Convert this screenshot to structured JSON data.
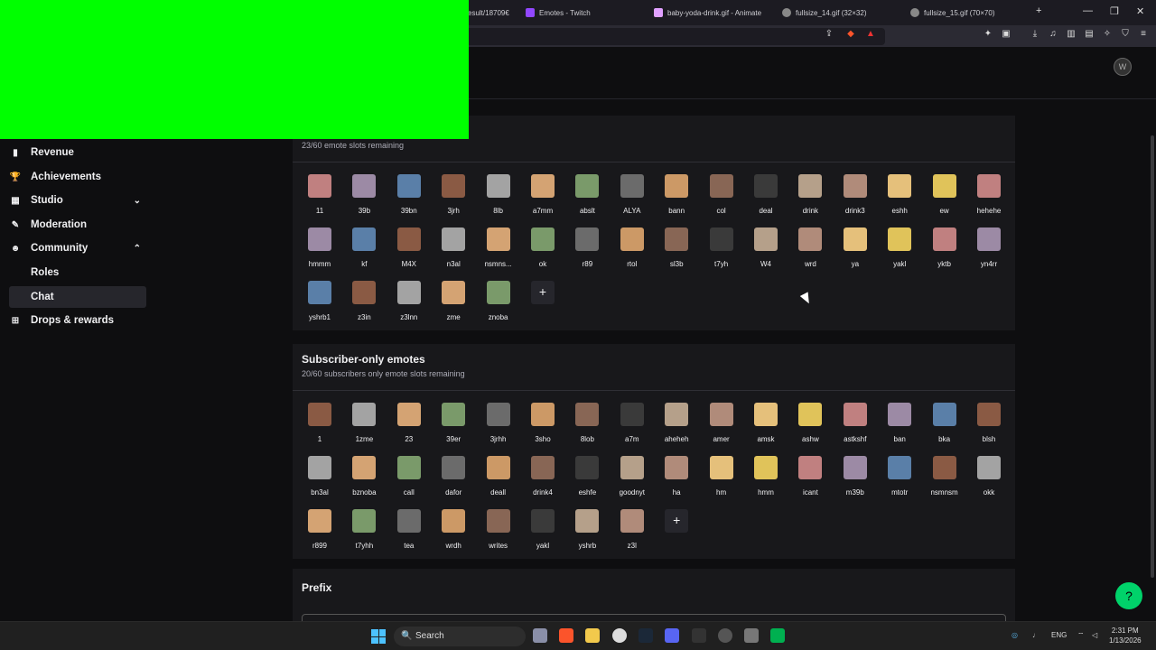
{
  "browser": {
    "tabs": [
      {
        "label": "esult/18709€",
        "icon_color": "#8a8a8a"
      },
      {
        "label": "Emotes - Twitch",
        "icon_color": "#9147ff"
      },
      {
        "label": "baby-yoda-drink.gif - Animate",
        "icon_color": "#e0a0ff"
      },
      {
        "label": "fullsize_14.gif (32×32)",
        "icon_color": "#cccccc"
      },
      {
        "label": "fullsize_15.gif (70×70)",
        "icon_color": "#cccccc"
      }
    ],
    "new_tab": "+",
    "win_minimize": "—",
    "win_restore": "❐",
    "win_close": "✕"
  },
  "sidebar": {
    "items": [
      {
        "label": "Revenue",
        "icon": "revenue-icon",
        "glyph": "▮",
        "chevron": ""
      },
      {
        "label": "Achievements",
        "icon": "trophy-icon",
        "glyph": "🏆",
        "chevron": ""
      },
      {
        "label": "Studio",
        "icon": "studio-icon",
        "glyph": "▦",
        "chevron": "⌄"
      },
      {
        "label": "Moderation",
        "icon": "wrench-icon",
        "glyph": "✎",
        "chevron": ""
      },
      {
        "label": "Community",
        "icon": "community-icon",
        "glyph": "☻",
        "chevron": "⌃"
      },
      {
        "label": "Roles",
        "icon": "",
        "glyph": "",
        "chevron": ""
      },
      {
        "label": "Chat",
        "icon": "",
        "glyph": "",
        "chevron": ""
      },
      {
        "label": "Drops & rewards",
        "icon": "gift-icon",
        "glyph": "⊞",
        "chevron": ""
      }
    ]
  },
  "tier_emotes": {
    "slots_remaining": "23/60 emote slots remaining",
    "emotes": [
      "11",
      "39b",
      "39bn",
      "3jrh",
      "8lb",
      "a7mm",
      "abslt",
      "ALYA",
      "bann",
      "col",
      "deal",
      "drink",
      "drink3",
      "eshh",
      "ew",
      "hehehe",
      "hmmm",
      "kf",
      "M4X",
      "n3al",
      "nsmns...",
      "ok",
      "r89",
      "rtol",
      "sl3b",
      "t7yh",
      "W4",
      "wrd",
      "ya",
      "yakl",
      "yktb",
      "yn4rr",
      "yshrb1",
      "z3in",
      "z3lnn",
      "zme",
      "znoba"
    ],
    "add_label": "+"
  },
  "subscriber_emotes": {
    "title": "Subscriber-only emotes",
    "slots_remaining": "20/60 subscribers only emote slots remaining",
    "emotes": [
      "1",
      "1zme",
      "23",
      "39er",
      "3jrhh",
      "3sho",
      "8lob",
      "a7m",
      "aheheh",
      "amer",
      "amsk",
      "ashw",
      "astkshf",
      "ban",
      "bka",
      "blsh",
      "bn3al",
      "bznoba",
      "call",
      "dafor",
      "deall",
      "drink4",
      "eshfe",
      "goodnyt",
      "ha",
      "hm",
      "hmm",
      "icant",
      "m39b",
      "mtotr",
      "nsmnsm",
      "okk",
      "r899",
      "t7yhh",
      "tea",
      "wrdh",
      "writes",
      "yakl",
      "yshrb",
      "z3l"
    ],
    "add_label": "+"
  },
  "prefix": {
    "title": "Prefix"
  },
  "taskbar": {
    "search_label": "Search",
    "search_icon": "🔍",
    "lang": "ENG",
    "time": "2:31 PM",
    "date": "1/13/2026"
  },
  "help_icon": "?",
  "colors": {
    "accent": "#9147ff",
    "green_screen": "#00ff00",
    "help": "#00d26a"
  }
}
